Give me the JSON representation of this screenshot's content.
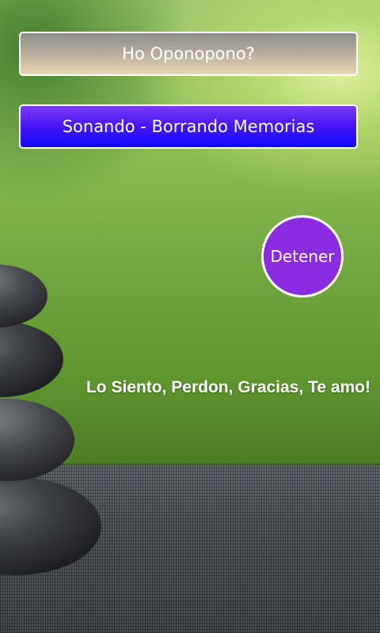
{
  "buttons": {
    "top_label": "Ho Oponopono?",
    "playing_label": "Sonando - Borrando Memorias",
    "stop_label": "Detener"
  },
  "affirmation": {
    "text": "Lo Siento, Perdon, Gracias, Te amo!"
  },
  "colors": {
    "top_button_gradient_start": "#8f8d8a",
    "top_button_gradient_end": "#e7d7b6",
    "playing_button_gradient_start": "#7a3cf4",
    "playing_button_gradient_end": "#1008ff",
    "stop_button": "#8b2be2",
    "button_border": "#ffffff",
    "text": "#ffffff"
  }
}
